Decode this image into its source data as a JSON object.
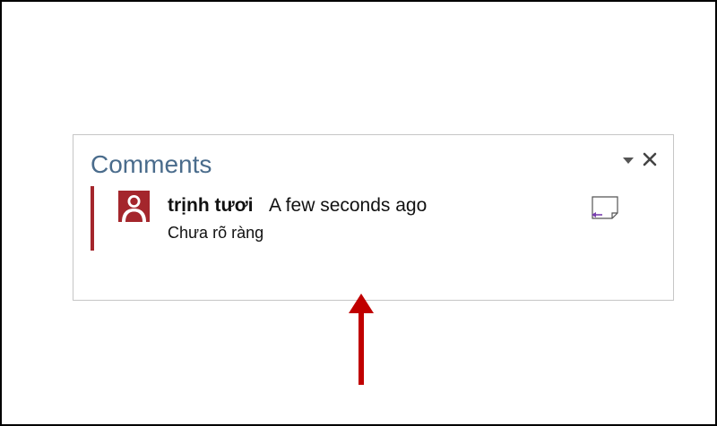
{
  "pane": {
    "title": "Comments",
    "icons": {
      "menu": "dropdown-arrow-icon",
      "close": "close-icon"
    }
  },
  "comment": {
    "author": "trịnh tươi",
    "time": "A few seconds ago",
    "text": "Chưa rõ ràng",
    "avatar_icon": "user-avatar-icon",
    "reply_icon": "reply-note-icon"
  },
  "colors": {
    "accent": "#a4262c",
    "title": "#4a6c8c",
    "arrow": "#c00000",
    "reply_arrow": "#7a3fb0"
  }
}
